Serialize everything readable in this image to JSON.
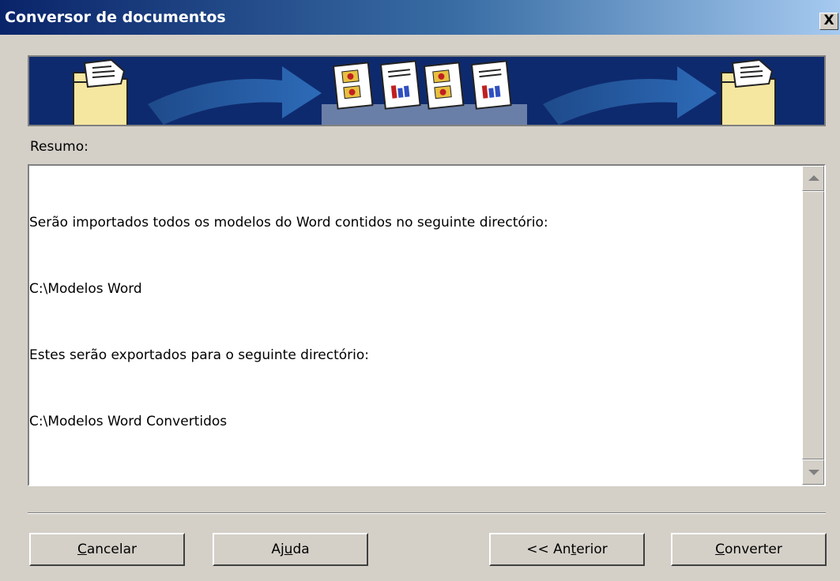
{
  "window": {
    "title": "Conversor de documentos",
    "close_label": "X"
  },
  "summary": {
    "label": "Resumo:",
    "lines": [
      "Serão importados todos os modelos do Word contidos no seguinte directório:",
      "C:\\Modelos Word",
      "Estes serão exportados para o seguinte directório:",
      "C:\\Modelos Word Convertidos"
    ]
  },
  "buttons": {
    "cancel": {
      "pre": "",
      "accel": "C",
      "post": "ancelar"
    },
    "help": {
      "pre": "Aj",
      "accel": "u",
      "post": "da"
    },
    "previous": {
      "pre": "<< An",
      "accel": "t",
      "post": "erior"
    },
    "convert": {
      "pre": "",
      "accel": "C",
      "post": "onverter"
    }
  },
  "colors": {
    "titlebar_start": "#0a246a",
    "titlebar_end": "#a6caf0",
    "banner_bg": "#0e2a6e",
    "dialog_bg": "#d4d0c8"
  },
  "icons": [
    "source-folder-icon",
    "arrow-icon",
    "documents-icon",
    "arrow-icon",
    "target-folder-icon"
  ]
}
